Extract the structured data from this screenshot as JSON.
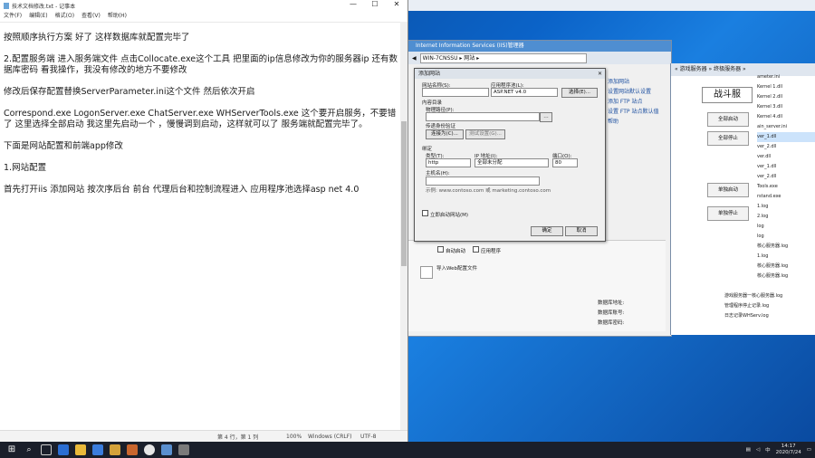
{
  "notepad": {
    "title": "技术文档修改.txt - 记事本",
    "menu": [
      "文件(F)",
      "编辑(E)",
      "格式(O)",
      "查看(V)",
      "帮助(H)"
    ],
    "paragraphs": [
      "按照顺序执行方案 好了 这样数据库就配置完毕了",
      "2.配置服务端 进入服务端文件 点击Collocate.exe这个工具 把里面的ip信息修改为你的服务器ip 还有数据库密码 看我操作，我没有修改的地方不要修改",
      "修改后保存配置替换ServerParameter.ini这个文件 然后依次开启",
      "Correspond.exe  LogonServer.exe  ChatServer.exe  WHServerTools.exe 这个要开启服务，不要错了 这里选择全部启动 我这里先启动一个 ，慢慢调到启动，这样就可以了 服务端就配置完毕了。",
      "下面是网站配置和前端app修改",
      "1.网站配置",
      "首先打开iis 添加网站 按次序后台 前台 代理后台和控制流程进入 应用程序池选择asp net 4.0"
    ],
    "status": {
      "pos": "第 4 行，第 1 列",
      "zoom": "100%",
      "eol": "Windows (CRLF)",
      "enc": "UTF-8"
    }
  },
  "iis": {
    "title": "Internet Information Services (IIS)管理器",
    "address": "WIN-7CNSSU  ▸  网站  ▸",
    "actions": [
      "添加网站",
      "设置网站默认设置",
      "添加 FTP 站点",
      "设置 FTP 站点默认值",
      "帮助"
    ],
    "check1": "自动启动",
    "check2": "应用程序",
    "tile_label": "导入Web配置文件"
  },
  "dialog": {
    "title": "添加网站",
    "site_name_label": "网站名称(S):",
    "site_name": "",
    "pool_label": "应用程序池(L):",
    "pool": "ASP.NET v4.0",
    "select_btn": "选择(E)...",
    "content_label": "内容目录",
    "phys_label": "物理路径(P):",
    "pass_label": "传递身份验证",
    "connect_btn": "连接为(C)...",
    "test_btn": "测试设置(G)...",
    "binding_label": "绑定",
    "type_label": "类型(T):",
    "type": "http",
    "ip_label": "IP 地址(I):",
    "ip": "全部未分配",
    "port_label": "端口(O):",
    "port": "80",
    "host_label": "主机名(H):",
    "example": "示例: www.contoso.com 或 marketing.contoso.com",
    "start_label": "立即启动网站(M)",
    "ok": "确定",
    "cancel": "取消"
  },
  "right": {
    "title": "« 游戏服务器 » 终极服务器 »",
    "big": "战斗服",
    "buttons": [
      "全部启动",
      "全部停止",
      "单独启动",
      "单独停止"
    ],
    "files": [
      "ameter.ini",
      "Kernel 1.dll",
      "Kernel 2.dll",
      "Kernel 3.dll",
      "Kernel 4.dll",
      "ain_server.ini",
      "ver_1.dll",
      "ver_2.dll",
      "ver.dll",
      "ver_1.dll",
      "ver_2.dll",
      "Tools.exe",
      "rstand.exe",
      "1.log",
      "2.log",
      "log",
      "log",
      "核心服务器.log",
      "1.log",
      "核心服务器.log",
      "核心服务器.log"
    ],
    "files_bottom": [
      "游戏服务器一核心服务器.log",
      "管理程序停止记录.log",
      "日志记录WHServ.log"
    ],
    "lower": [
      "数据库地址:",
      "数据库账号:",
      "数据库密码:"
    ]
  },
  "taskbar": {
    "time": "14:17",
    "date": "2020/7/24"
  }
}
